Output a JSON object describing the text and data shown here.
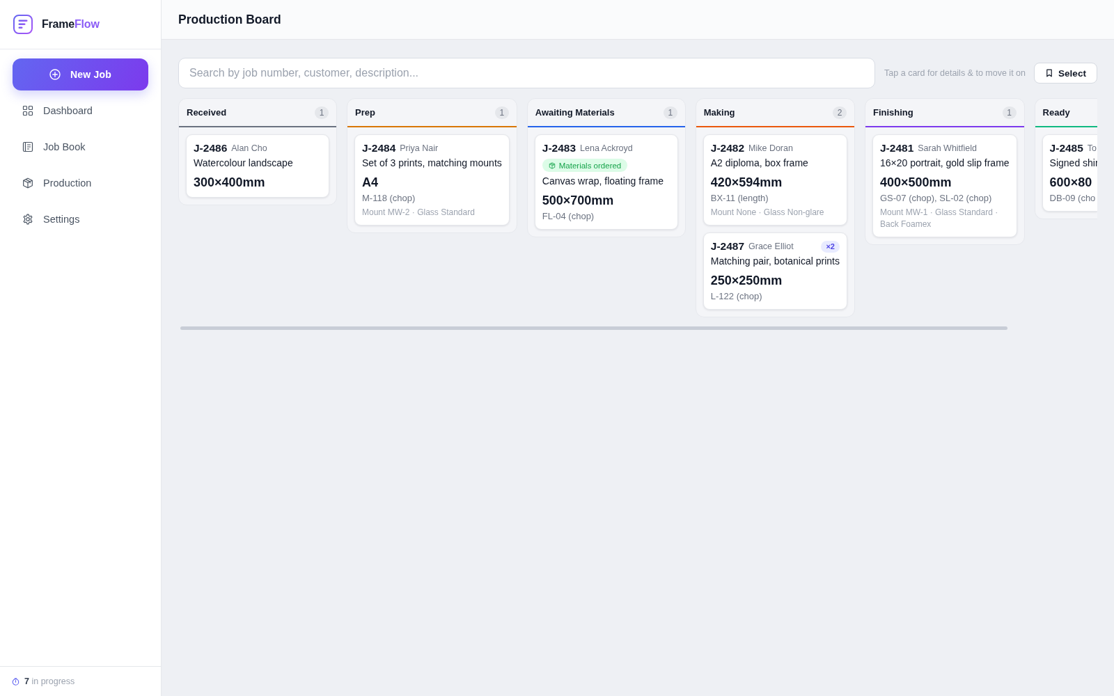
{
  "sidebar": {
    "brand": {
      "name": "Frame",
      "accent": "Flow"
    },
    "new_job_button": "New Job",
    "items": [
      {
        "label": "Dashboard",
        "selected": false
      },
      {
        "label": "Job Book",
        "selected": false
      },
      {
        "label": "Production",
        "selected": false
      },
      {
        "label": "Settings",
        "selected": false
      }
    ],
    "footer": "**7** in progress"
  },
  "header": {
    "title": "Production Board"
  },
  "toolbar": {
    "search": {
      "placeholder": "Search by job number, customer, description..."
    },
    "hint": "Tap a card for details & to move it on",
    "select_button": "Select"
  },
  "board": {
    "columns": [
      {
        "title": "Received",
        "count": "1",
        "color": "#6b7280",
        "cards": [
          {
            "job": "J-2486",
            "customer": "Alan Cho",
            "description": "Watercolour landscape",
            "size": "300×400mm"
          }
        ]
      },
      {
        "title": "Prep",
        "count": "1",
        "color": "#d97706",
        "cards": [
          {
            "job": "J-2484",
            "customer": "Priya Nair",
            "description": "Set of 3 prints, matching mounts",
            "size": "A4",
            "moulding": "M-118 (chop)",
            "details": "Mount MW-2 · Glass Standard"
          }
        ]
      },
      {
        "title": "Awaiting Materials",
        "count": "1",
        "color": "#2563eb",
        "cards": [
          {
            "job": "J-2483",
            "customer": "Lena Ackroyd",
            "status": "Materials ordered",
            "description": "Canvas wrap, floating frame",
            "size": "500×700mm",
            "moulding": "FL-04 (chop)"
          }
        ]
      },
      {
        "title": "Making",
        "count": "2",
        "color": "#ea580c",
        "cards": [
          {
            "job": "J-2482",
            "customer": "Mike Doran",
            "description": "A2 diploma, box frame",
            "size": "420×594mm",
            "moulding": "BX-11 (length)",
            "details": "Mount None · Glass Non-glare"
          },
          {
            "job": "J-2487",
            "customer": "Grace Elliot",
            "quantity": "×2",
            "description": "Matching pair, botanical prints",
            "size": "250×250mm",
            "moulding": "L-122 (chop)"
          }
        ]
      },
      {
        "title": "Finishing",
        "count": "1",
        "color": "#7c3aed",
        "cards": [
          {
            "job": "J-2481",
            "customer": "Sarah Whitfield",
            "description": "16×20 portrait, gold slip frame",
            "size": "400×500mm",
            "moulding": "GS-07 (chop), SL-02 (chop)",
            "details": "Mount MW-1 · Glass Standard · Back Foamex"
          }
        ]
      },
      {
        "title": "Ready",
        "color": "#10b981",
        "cards": [
          {
            "job": "J-2485",
            "customer": "To",
            "description": "Signed shir",
            "size": "600×80",
            "moulding": "DB-09 (cho"
          }
        ]
      }
    ]
  }
}
